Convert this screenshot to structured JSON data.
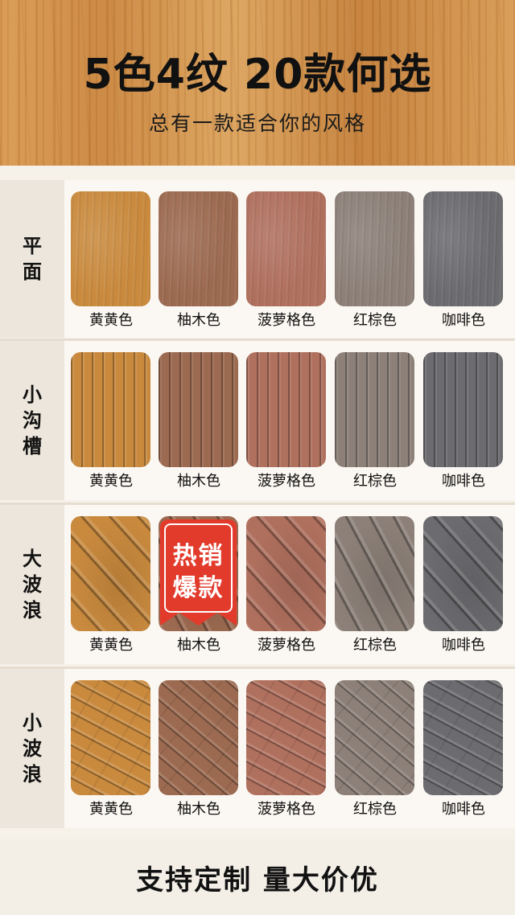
{
  "header": {
    "title": "5色4纹 20款何选",
    "subtitle": "总有一款适合你的风格"
  },
  "footer": {
    "text": "支持定制 量大价优"
  },
  "badge": {
    "line1": "热销",
    "line2": "爆款",
    "color": "#e23b2c"
  },
  "colors": [
    "黄黄色",
    "柚木色",
    "菠萝格色",
    "红棕色",
    "咖啡色"
  ],
  "rows": [
    {
      "label": "平面",
      "texture": "flat"
    },
    {
      "label": "小沟槽",
      "texture": "groove"
    },
    {
      "label": "大波浪",
      "texture": "bigwave"
    },
    {
      "label": "小波浪",
      "texture": "smallwave"
    }
  ],
  "swatch_colors": [
    "#c98a3e",
    "#9c6a50",
    "#b0705e",
    "#8c8078",
    "#6c6c70"
  ]
}
